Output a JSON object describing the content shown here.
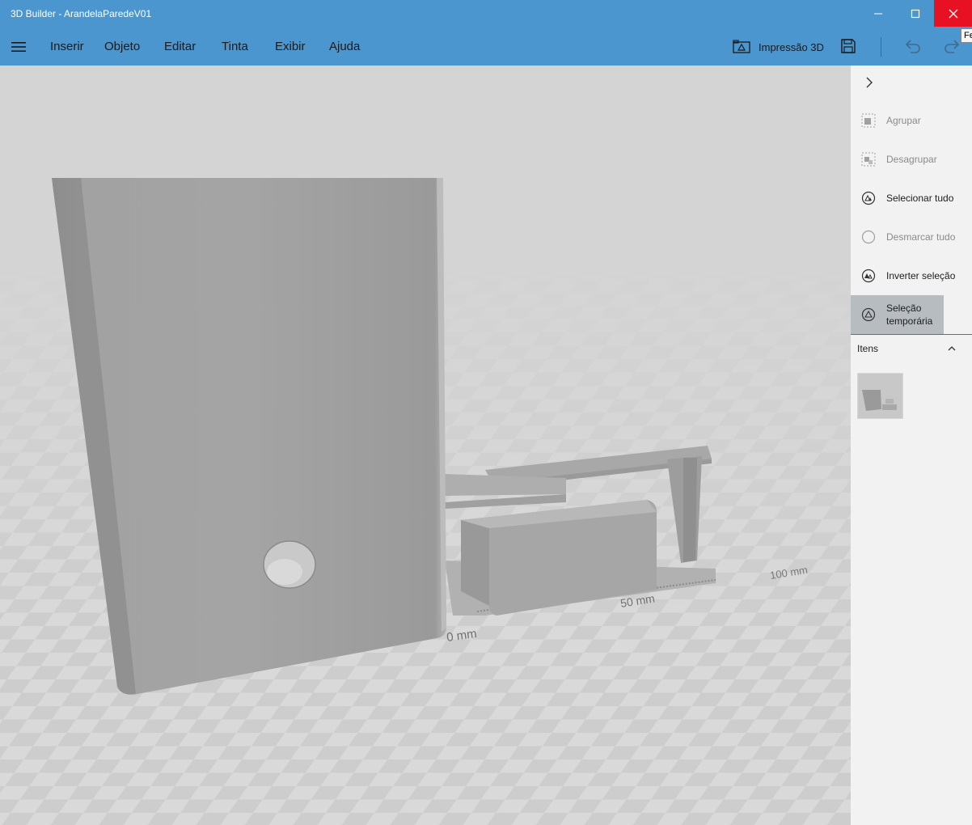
{
  "window": {
    "title": "3D Builder - ArandelaParedeV01",
    "tooltip": "Fe",
    "colors": {
      "accent": "#4b96cf",
      "close": "#e81123",
      "panel": "#f2f2f2"
    }
  },
  "menu": {
    "items": [
      {
        "label": "Inserir"
      },
      {
        "label": "Objeto"
      },
      {
        "label": "Editar"
      },
      {
        "label": "Tinta"
      },
      {
        "label": "Exibir"
      },
      {
        "label": "Ajuda"
      }
    ],
    "print_label": "Impressão 3D"
  },
  "viewport": {
    "scale_labels": [
      "0 mm",
      "50 mm",
      "100 mm"
    ]
  },
  "panel": {
    "actions": [
      {
        "label": "Agrupar",
        "state": "disabled",
        "icon": "group-icon"
      },
      {
        "label": "Desagrupar",
        "state": "disabled",
        "icon": "ungroup-icon"
      },
      {
        "label": "Selecionar tudo",
        "state": "enabled",
        "icon": "select-all-icon"
      },
      {
        "label": "Desmarcar tudo",
        "state": "disabled",
        "icon": "deselect-all-icon"
      },
      {
        "label": "Inverter seleção",
        "state": "enabled",
        "icon": "invert-selection-icon"
      },
      {
        "label_line1": "Seleção",
        "label_line2": "temporária",
        "state": "active",
        "icon": "temporary-selection-icon"
      }
    ],
    "items_header": "Itens"
  }
}
